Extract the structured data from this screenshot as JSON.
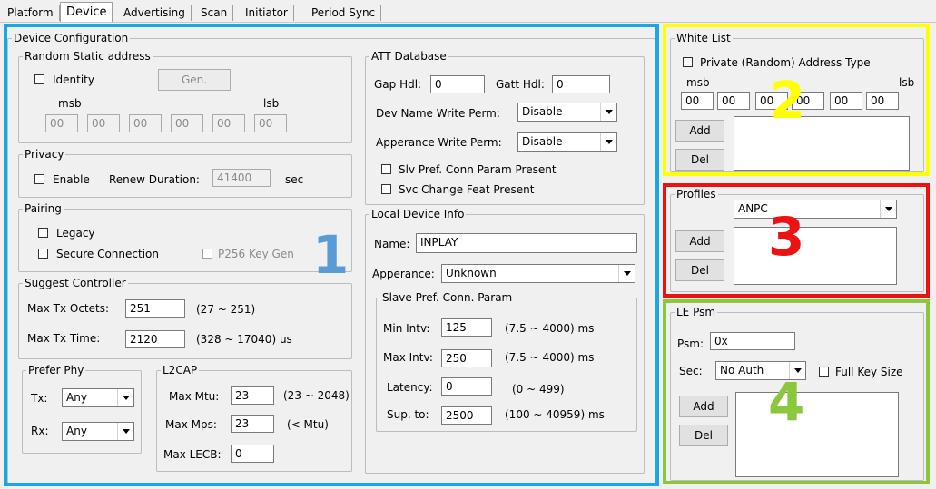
{
  "tabs": [
    "Platform",
    "Device",
    "Advertising",
    "Scan",
    "Initiator",
    "Period Sync"
  ],
  "device_config": {
    "title": "Device Configuration",
    "random_static": {
      "title": "Random Static address",
      "identity_label": "Identity",
      "gen_button": "Gen.",
      "msb": "msb",
      "lsb": "lsb",
      "bytes": [
        "00",
        "00",
        "00",
        "00",
        "00",
        "00"
      ]
    },
    "privacy": {
      "title": "Privacy",
      "enable_label": "Enable",
      "renew_label": "Renew Duration:",
      "renew_value": "41400",
      "unit": "sec"
    },
    "pairing": {
      "title": "Pairing",
      "legacy_label": "Legacy",
      "secure_label": "Secure Connection",
      "p256_label": "P256 Key Gen"
    },
    "suggest": {
      "title": "Suggest Controller",
      "tx_octets_label": "Max Tx Octets:",
      "tx_octets_value": "251",
      "tx_octets_range": "(27 ~ 251)",
      "tx_time_label": "Max Tx Time:",
      "tx_time_value": "2120",
      "tx_time_range": "(328 ~ 17040) us"
    },
    "prefer_phy": {
      "title": "Prefer Phy",
      "tx_label": "Tx:",
      "tx_value": "Any",
      "rx_label": "Rx:",
      "rx_value": "Any"
    },
    "l2cap": {
      "title": "L2CAP",
      "mtu_label": "Max Mtu:",
      "mtu_value": "23",
      "mtu_range": "(23 ~ 2048)",
      "mps_label": "Max Mps:",
      "mps_value": "23",
      "mps_range": "(< Mtu)",
      "lecb_label": "Max LECB:",
      "lecb_value": "0"
    },
    "att": {
      "title": "ATT Database",
      "gap_label": "Gap Hdl:",
      "gap_value": "0",
      "gatt_label": "Gatt Hdl:",
      "gatt_value": "0",
      "devname_label": "Dev Name Write Perm:",
      "devname_value": "Disable",
      "appear_label": "Apperance Write Perm:",
      "appear_value": "Disable",
      "slv_label": "Slv Pref. Conn Param Present",
      "svc_label": "Svc Change Feat Present"
    },
    "local": {
      "title": "Local Device Info",
      "name_label": "Name:",
      "name_value": "INPLAY",
      "appear_label": "Apperance:",
      "appear_value": "Unknown",
      "slave": {
        "title": "Slave Pref. Conn. Param",
        "min_label": "Min Intv:",
        "min_value": "125",
        "min_range": "(7.5 ~ 4000) ms",
        "max_label": "Max Intv:",
        "max_value": "250",
        "max_range": "(7.5 ~ 4000) ms",
        "lat_label": "Latency:",
        "lat_value": "0",
        "lat_range": "(0 ~ 499)",
        "sup_label": "Sup. to:",
        "sup_value": "2500",
        "sup_range": "(100 ~ 40959) ms"
      }
    }
  },
  "white_list": {
    "title": "White List",
    "private_label": "Private (Random) Address Type",
    "msb": "msb",
    "lsb": "lsb",
    "bytes": [
      "00",
      "00",
      "00",
      "00",
      "00",
      "00"
    ],
    "add": "Add",
    "del": "Del"
  },
  "profiles": {
    "title": "Profiles",
    "value": "ANPC",
    "add": "Add",
    "del": "Del"
  },
  "le_psm": {
    "title": "LE Psm",
    "psm_label": "Psm:",
    "psm_value": "0x",
    "sec_label": "Sec:",
    "sec_value": "No Auth",
    "fullkey_label": "Full Key Size",
    "add": "Add",
    "del": "Del"
  },
  "annotations": {
    "n1": "1",
    "n2": "2",
    "n3": "3",
    "n4": "4",
    "colors": {
      "blue": "#1aa7e8",
      "yellow": "#ffff00",
      "red": "#ee1111",
      "green": "#8cc63f",
      "blue_num": "#5b9bd5"
    }
  }
}
